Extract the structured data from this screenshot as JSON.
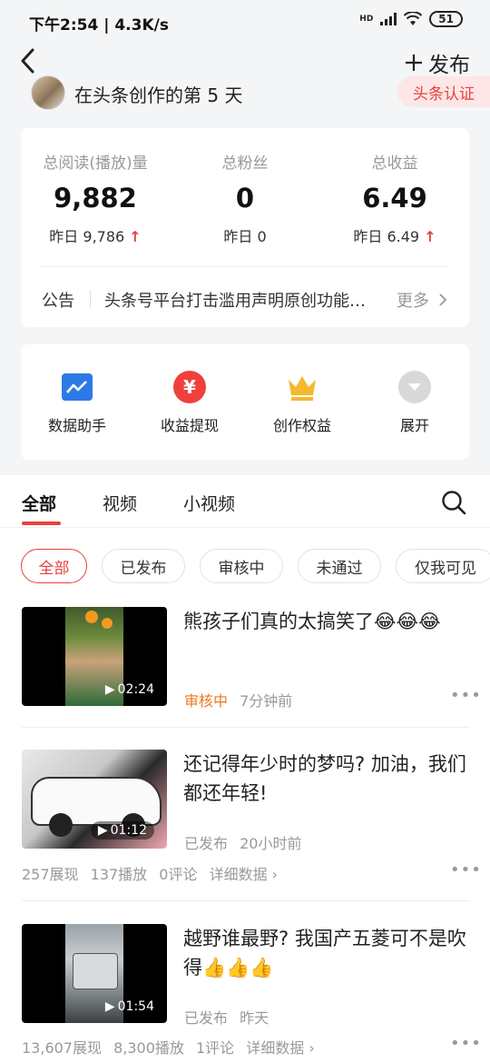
{
  "status_bar": {
    "time": "下午2:54 | 4.3K/s",
    "network": "HD",
    "battery": "51"
  },
  "header": {
    "publish_label": "发布",
    "creator_days": "在头条创作的第 5 天",
    "certification": "头条认证"
  },
  "stats": [
    {
      "label": "总阅读(播放)量",
      "value": "9,882",
      "yesterday": "昨日 9,786",
      "trend_up": true
    },
    {
      "label": "总粉丝",
      "value": "0",
      "yesterday": "昨日 0",
      "trend_up": false
    },
    {
      "label": "总收益",
      "value": "6.49",
      "yesterday": "昨日 6.49",
      "trend_up": true
    }
  ],
  "notice": {
    "label": "公告",
    "text": "头条号平台打击滥用声明原创功能行为",
    "more": "更多"
  },
  "tools": [
    {
      "label": "数据助手",
      "icon": "chart-icon",
      "color": "#2d7ae6"
    },
    {
      "label": "收益提现",
      "icon": "yen-icon",
      "color": "#f0403c"
    },
    {
      "label": "创作权益",
      "icon": "crown-icon",
      "color": "#f5b82e"
    },
    {
      "label": "展开",
      "icon": "expand-icon",
      "color": "#d8d8d8"
    }
  ],
  "tabs": [
    "全部",
    "视频",
    "小视频"
  ],
  "filters": [
    "全部",
    "已发布",
    "审核中",
    "未通过",
    "仅我可见"
  ],
  "items": [
    {
      "title": "熊孩子们真的太搞笑了😂😂😂",
      "duration": "02:24",
      "status": "审核中",
      "status_color": "#f07820",
      "time": "7分钟前",
      "stats": null
    },
    {
      "title": "还记得年少时的梦吗? 加油，我们都还年轻!",
      "duration": "01:12",
      "status": "已发布",
      "status_color": "#999999",
      "time": "20小时前",
      "stats": {
        "views": "257展现",
        "plays": "137播放",
        "comments": "0评论",
        "detail": "详细数据"
      }
    },
    {
      "title": "越野谁最野? 我国产五菱可不是吹得👍👍👍",
      "duration": "01:54",
      "status": "已发布",
      "status_color": "#999999",
      "time": "昨天",
      "stats": {
        "views": "13,607展现",
        "plays": "8,300播放",
        "comments": "1评论",
        "detail": "详细数据"
      }
    }
  ]
}
